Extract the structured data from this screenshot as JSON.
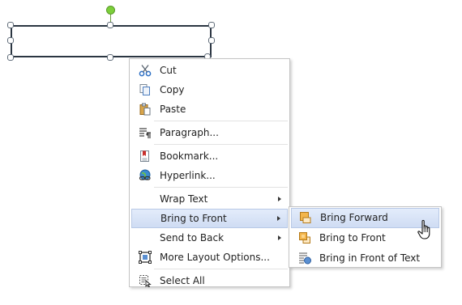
{
  "context_menu": {
    "items": [
      {
        "label": "Cut",
        "icon": "scissors-icon"
      },
      {
        "label": "Copy",
        "icon": "copy-icon"
      },
      {
        "label": "Paste",
        "icon": "paste-icon"
      },
      {
        "label": "Paragraph...",
        "icon": "paragraph-icon"
      },
      {
        "label": "Bookmark...",
        "icon": "bookmark-icon"
      },
      {
        "label": "Hyperlink...",
        "icon": "hyperlink-icon"
      },
      {
        "label": "Wrap Text",
        "icon": null,
        "submenu": true
      },
      {
        "label": "Bring to Front",
        "icon": null,
        "submenu": true,
        "highlighted": true
      },
      {
        "label": "Send to Back",
        "icon": null,
        "submenu": true
      },
      {
        "label": "More Layout Options...",
        "icon": "layout-options-icon"
      },
      {
        "label": "Select All",
        "icon": "select-all-icon"
      }
    ]
  },
  "submenu": {
    "parent": "Bring to Front",
    "items": [
      {
        "label": "Bring Forward",
        "icon": "bring-forward-icon",
        "highlighted": true
      },
      {
        "label": "Bring to Front",
        "icon": "bring-to-front-icon"
      },
      {
        "label": "Bring in Front of Text",
        "icon": "bring-in-front-of-text-icon"
      }
    ]
  },
  "colors": {
    "highlight": "#cfdcf3",
    "rotation_handle": "#7ccf3a",
    "shape_border": "#2b3642"
  }
}
